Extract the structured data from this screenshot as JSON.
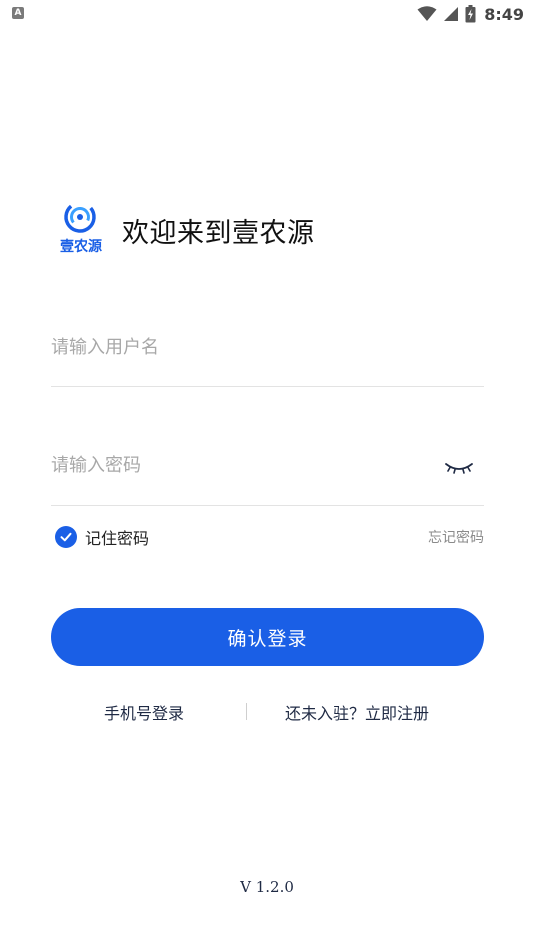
{
  "status_bar": {
    "left_badge": "A",
    "time": "8:49"
  },
  "header": {
    "logo_text": "壹农源",
    "welcome_title": "欢迎来到壹农源"
  },
  "form": {
    "username_placeholder": "请输入用户名",
    "username_value": "",
    "password_placeholder": "请输入密码",
    "password_value": "",
    "remember_label": "记住密码",
    "remember_checked": true,
    "forgot_label": "忘记密码",
    "login_label": "确认登录"
  },
  "links": {
    "phone_login": "手机号登录",
    "register": "还未入驻？立即注册"
  },
  "footer": {
    "version": "V 1.2.0"
  },
  "colors": {
    "accent": "#1a5fe6",
    "text_dark": "#1f2a44",
    "placeholder": "#a8a8a8"
  },
  "icons": {
    "wifi": "wifi-icon",
    "signal": "signal-icon",
    "battery": "battery-icon",
    "eye_closed": "eye-closed-icon",
    "check": "check-icon"
  }
}
